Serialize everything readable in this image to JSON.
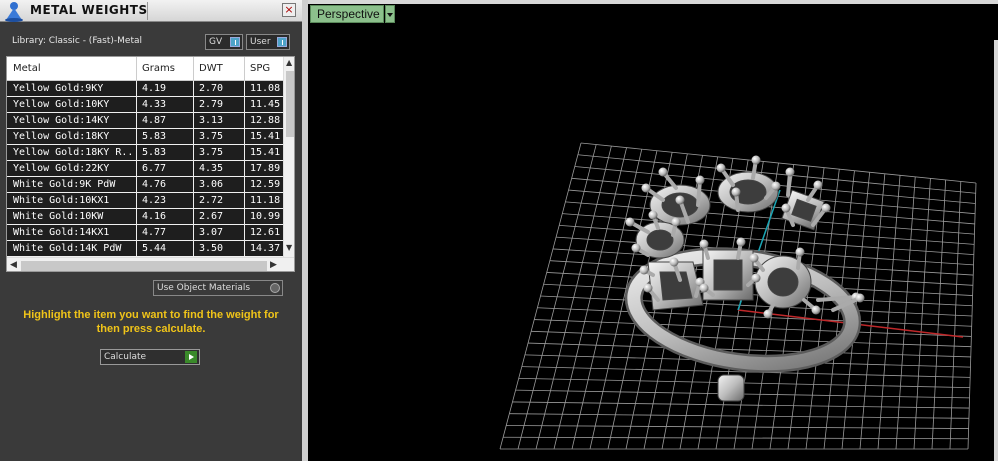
{
  "panel": {
    "title": "METAL WEIGHTS",
    "close_label": "×",
    "library": "Library: Classic - (Fast)-Metal",
    "toggles": [
      "GV",
      "User"
    ],
    "columns": [
      "Metal",
      "Grams",
      "DWT",
      "SPG"
    ],
    "rows": [
      [
        "Yellow Gold:9KY",
        "4.19",
        "2.70",
        "11.08"
      ],
      [
        "Yellow Gold:10KY",
        "4.33",
        "2.79",
        "11.45"
      ],
      [
        "Yellow Gold:14KY",
        "4.87",
        "3.13",
        "12.88"
      ],
      [
        "Yellow Gold:18KY",
        "5.83",
        "3.75",
        "15.41"
      ],
      [
        "Yellow Gold:18KY R...",
        "5.83",
        "3.75",
        "15.41"
      ],
      [
        "Yellow Gold:22KY",
        "6.77",
        "4.35",
        "17.89"
      ],
      [
        "White Gold:9K PdW",
        "4.76",
        "3.06",
        "12.59"
      ],
      [
        "White Gold:10KX1",
        "4.23",
        "2.72",
        "11.18"
      ],
      [
        "White Gold:10KW",
        "4.16",
        "2.67",
        "10.99"
      ],
      [
        "White Gold:14KX1",
        "4.77",
        "3.07",
        "12.61"
      ],
      [
        "White Gold:14K PdW",
        "5.44",
        "3.50",
        "14.37"
      ]
    ],
    "use_object_materials": "Use Object Materials",
    "hint": "Highlight the item you want to find the weight for then press calculate.",
    "calculate_label": "Calculate"
  },
  "viewport": {
    "view_label": "Perspective"
  },
  "colors": {
    "hint": "#f0c419",
    "view_tab": "#8cc08c",
    "axis_x": "#c0282a",
    "axis_y": "#1aa6b5"
  }
}
